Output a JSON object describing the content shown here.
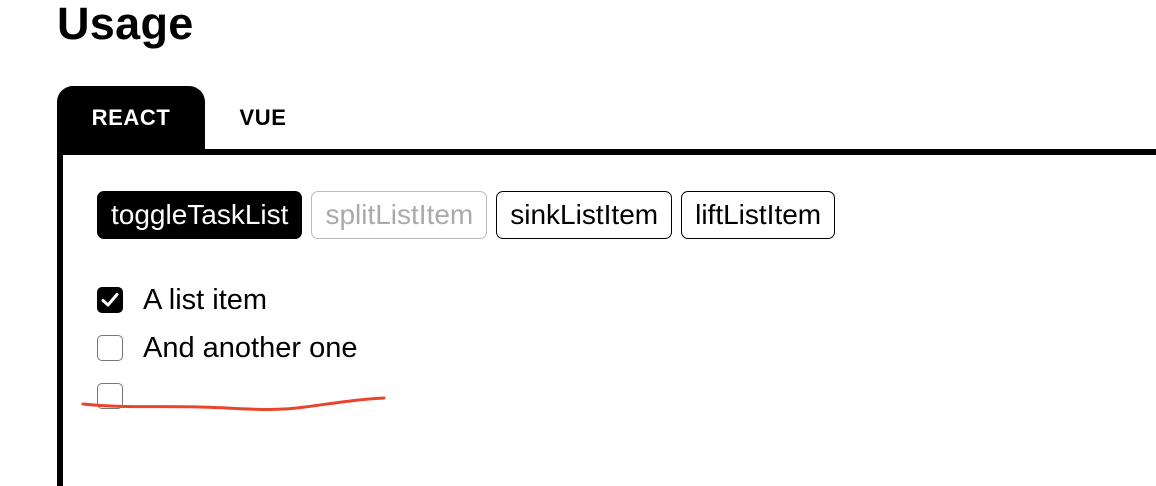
{
  "page": {
    "title": "Usage"
  },
  "tabs": [
    {
      "label": "REACT",
      "active": true
    },
    {
      "label": "VUE",
      "active": false
    }
  ],
  "toolbar": {
    "buttons": [
      {
        "label": "toggleTaskList",
        "state": "active"
      },
      {
        "label": "splitListItem",
        "state": "disabled"
      },
      {
        "label": "sinkListItem",
        "state": "enabled"
      },
      {
        "label": "liftListItem",
        "state": "enabled"
      }
    ]
  },
  "task_list": {
    "items": [
      {
        "text": "A list item",
        "checked": true
      },
      {
        "text": "And another one",
        "checked": false
      },
      {
        "text": "",
        "checked": false
      }
    ]
  },
  "annotation": {
    "type": "hand-drawn underline",
    "color": "#e8452c"
  }
}
